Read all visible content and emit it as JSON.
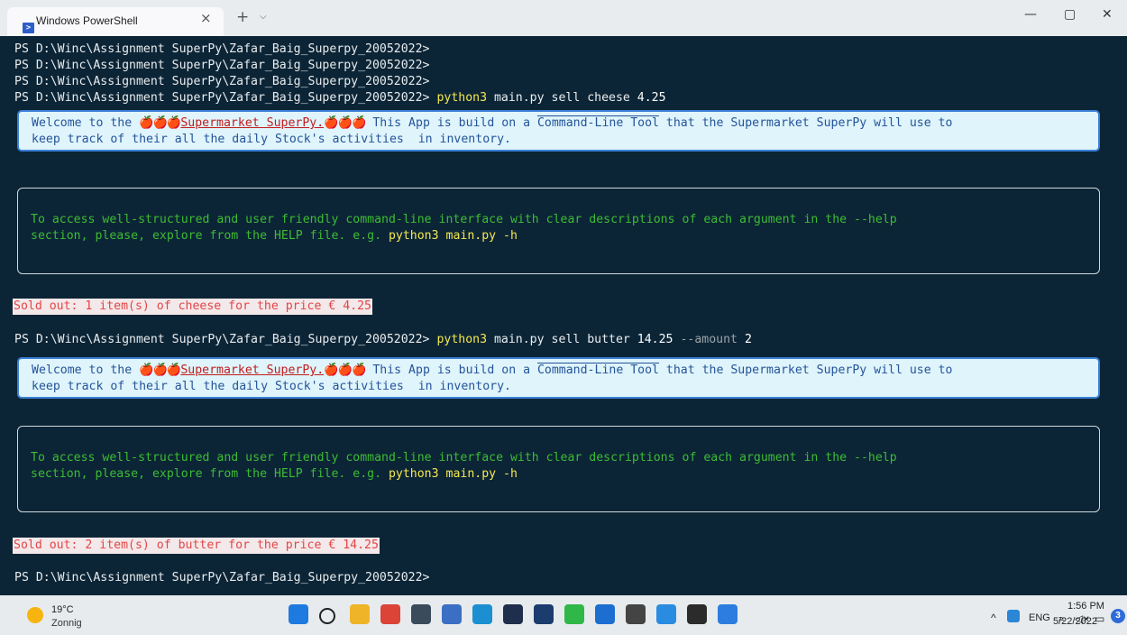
{
  "window": {
    "tab_title": "Windows PowerShell",
    "tab_close": "×",
    "new_tab": "+",
    "tab_dropdown": "⌵",
    "minimize": "—",
    "maximize": "▢",
    "close": "✕"
  },
  "terminal": {
    "prompt": "PS D:\\Winc\\Assignment SuperPy\\Zafar_Baig_Superpy_20052022>",
    "command1": {
      "program": "python3",
      "args": "main.py sell cheese",
      "price": "4.25"
    },
    "command2": {
      "program": "python3",
      "args": "main.py sell butter",
      "price": "14.25",
      "flag": "--amount",
      "amount": "2"
    },
    "welcome": {
      "prefix": "Welcome to the ",
      "apples": "🍎🍎🍎",
      "name": "Supermarket SuperPy.",
      "middle": " This App is build on a ",
      "tool": "Command-Line Tool",
      "suffix": " that the Supermarket SuperPy will use to",
      "line2": "keep track of their all the daily Stock's activities  in inventory."
    },
    "help": {
      "line1": "To access well-structured and user friendly command-line interface with clear descriptions of each argument in the --help",
      "line2_prefix": "section, please, explore from the HELP file. e.g. ",
      "line2_example": "python3 main.py -h"
    },
    "sold1": "Sold out: 1 item(s) of cheese for the price € 4.25",
    "sold2": "Sold out: 2 item(s) of butter for the price € 14.25"
  },
  "taskbar": {
    "temperature": "19°C",
    "condition": "Zonnig",
    "language": "ENG",
    "time": "1:56 PM",
    "date": "5/22/2022",
    "notifications": "3",
    "icons": [
      "windows-start-icon",
      "search-icon",
      "file-explorer-icon",
      "chrome-icon",
      "calculator-icon",
      "notepad-icon",
      "edge-icon",
      "photoshop-icon",
      "mail-icon",
      "whatsapp-icon",
      "onedrive-icon",
      "remote-icon",
      "vscode-icon",
      "terminal-icon",
      "notes-icon"
    ]
  }
}
